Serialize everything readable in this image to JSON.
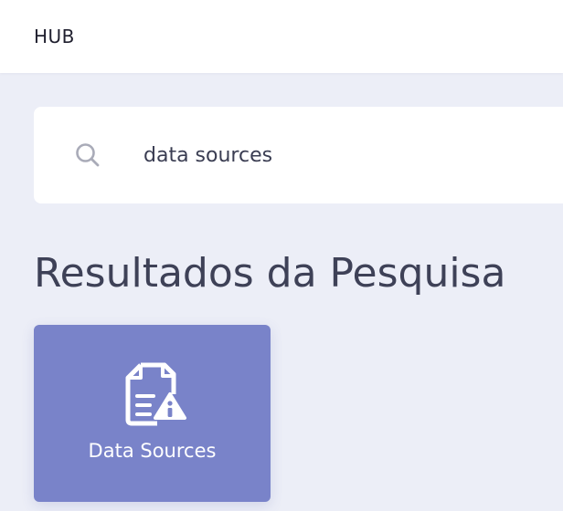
{
  "header": {
    "brand": "HUB"
  },
  "search": {
    "value": "data sources",
    "icon": "search-icon"
  },
  "results": {
    "title": "Resultados da Pesquisa",
    "items": [
      {
        "label": "Data Sources",
        "icon": "document-info-icon",
        "color": "#7983c9"
      }
    ]
  }
}
